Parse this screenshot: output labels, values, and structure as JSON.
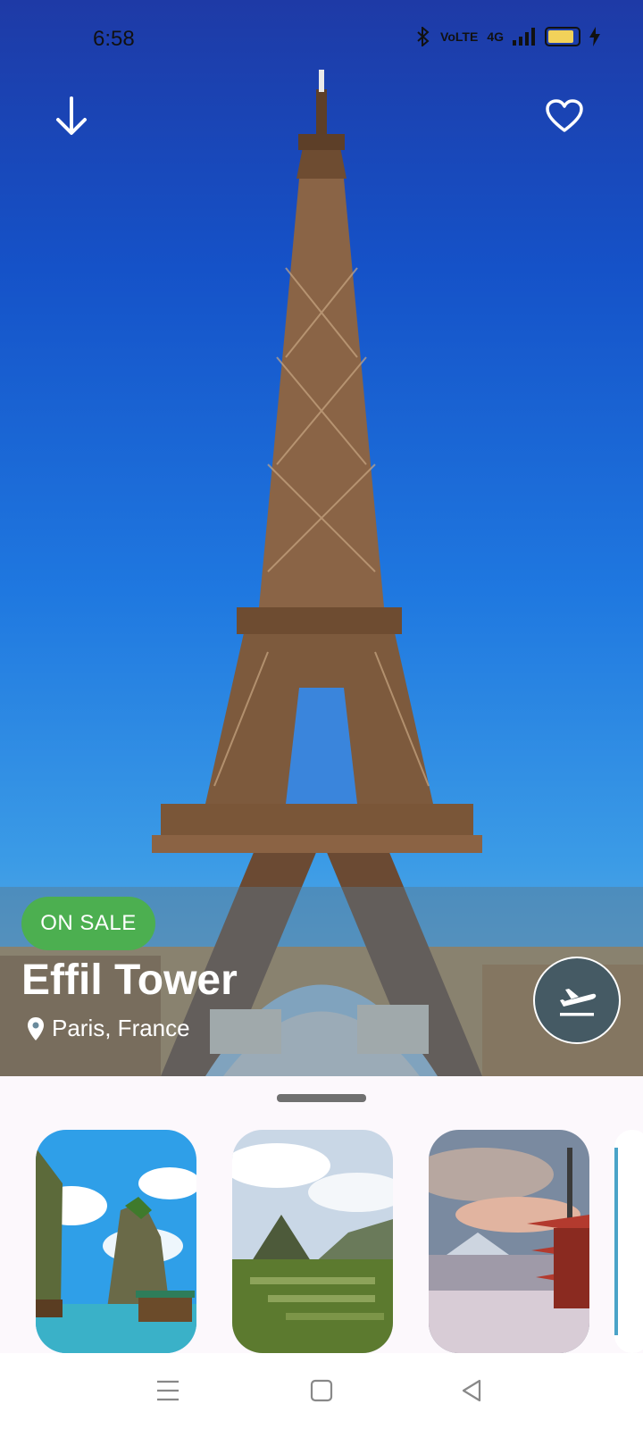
{
  "status_bar": {
    "time": "6:58",
    "indicators": [
      "bluetooth-icon",
      "volte-icon",
      "4g-signal-icon",
      "signal-icon",
      "battery-icon",
      "charging-icon"
    ],
    "volte_label": "VoLTE",
    "net_label": "4G"
  },
  "header": {
    "back_icon": "arrow-down-icon",
    "favorite_icon": "heart-outline-icon"
  },
  "place": {
    "badge": "ON SALE",
    "title": "Effil Tower",
    "location": "Paris, France",
    "location_icon": "location-pin-icon"
  },
  "fab": {
    "icon": "flight-takeoff-icon"
  },
  "gallery": {
    "items": [
      {
        "name": "ha-long-bay-thumbnail"
      },
      {
        "name": "machu-picchu-thumbnail"
      },
      {
        "name": "mount-fuji-pagoda-thumbnail"
      }
    ]
  },
  "nav": {
    "items": [
      "menu-icon",
      "home-square-icon",
      "back-triangle-icon"
    ]
  },
  "colors": {
    "badge_green": "#4caf50",
    "fab_gray": "#455a64",
    "sky_blue": "#1f78e0"
  }
}
